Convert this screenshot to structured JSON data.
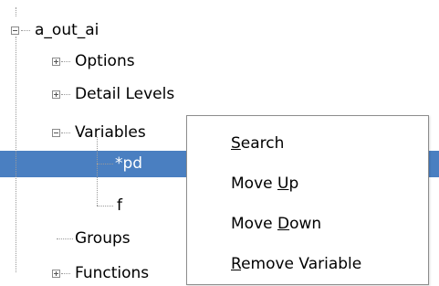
{
  "tree": {
    "root": {
      "label": "a_out_ai",
      "expanded": true
    },
    "nodes": {
      "options": {
        "label": "Options",
        "expanded": false
      },
      "detail_levels": {
        "label": "Detail Levels",
        "expanded": false
      },
      "variables": {
        "label": "Variables",
        "expanded": true
      },
      "pd": {
        "label": "*pd",
        "selected": true
      },
      "f": {
        "label": "f"
      },
      "groups": {
        "label": "Groups"
      },
      "functions": {
        "label": "Functions",
        "expanded": false
      }
    }
  },
  "context_menu": {
    "items": [
      {
        "pre": "",
        "mn": "S",
        "post": "earch"
      },
      {
        "pre": "Move ",
        "mn": "U",
        "post": "p"
      },
      {
        "pre": "Move ",
        "mn": "D",
        "post": "own"
      },
      {
        "pre": "",
        "mn": "R",
        "post": "emove Variable"
      }
    ]
  },
  "colors": {
    "selection": "#4a7fc1",
    "selected_text": "#ffffff",
    "tree_lines": "#9a9a9a"
  },
  "icons": {
    "expanded": "minus-box-icon",
    "collapsed": "plus-box-icon"
  }
}
